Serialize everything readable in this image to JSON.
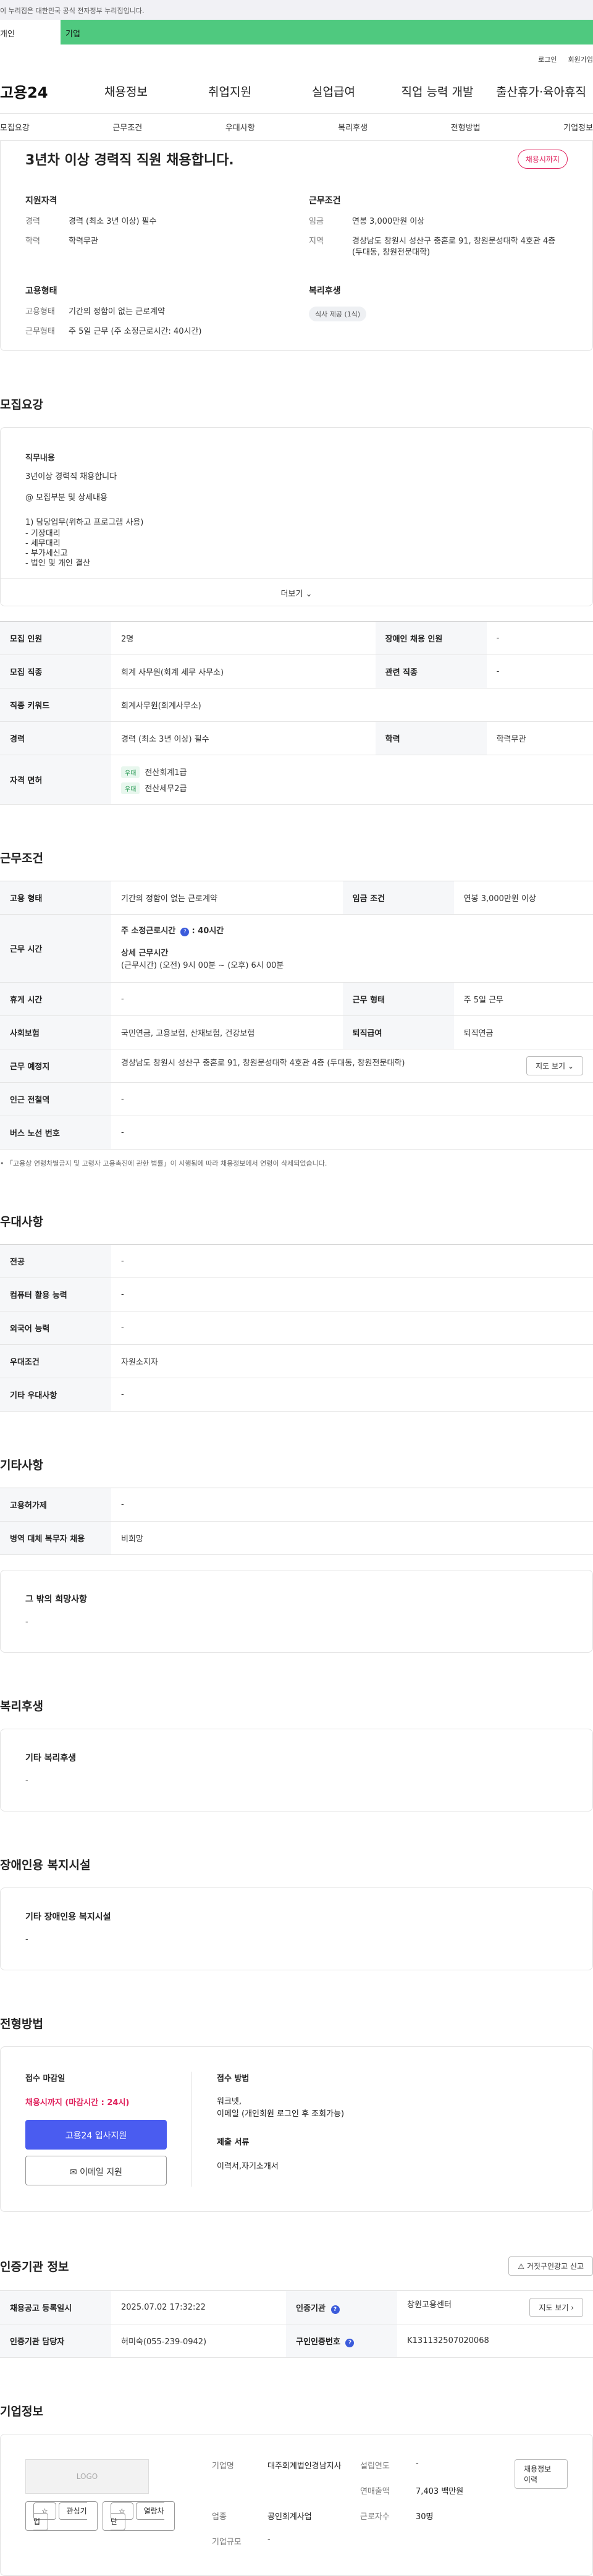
{
  "gov_banner": "이 누리집은 대한민국 공식 전자정부 누리집입니다.",
  "top_tabs": {
    "individual": "개인",
    "enterprise": "기업"
  },
  "util": {
    "login": "로그인",
    "signup": "회원가입"
  },
  "logo": "고용24",
  "gnb": [
    "채용정보",
    "취업지원",
    "실업급여",
    "직업 능력 개발",
    "출산휴가·육아휴직"
  ],
  "anchor_tabs": [
    "모집요강",
    "근무조건",
    "우대사항",
    "복리후생",
    "전형방법",
    "기업정보"
  ],
  "summary": {
    "title": "3년차 이상 경력직 직원 채용합니다.",
    "badge": "채용시까지",
    "qual_title": "지원자격",
    "qual": [
      {
        "k": "경력",
        "v": "경력 (최소 3년 이상) 필수"
      },
      {
        "k": "학력",
        "v": "학력무관"
      }
    ],
    "cond_title": "근무조건",
    "cond": [
      {
        "k": "임금",
        "v": "연봉 3,000만원 이상"
      },
      {
        "k": "지역",
        "v": "경상남도 창원시 성산구 충혼로 91, 창원문성대학 4호관 4층 (두대동, 창원전문대학)"
      }
    ],
    "emp_title": "고용형태",
    "emp": [
      {
        "k": "고용형태",
        "v": "기간의 정함이 없는 근로계약"
      },
      {
        "k": "근무형태",
        "v": "주 5일 근무 (주 소정근로시간: 40시간)"
      }
    ],
    "welfare_title": "복리후생",
    "welfare_chip": "식사 제공 (1식)"
  },
  "recruit": {
    "title": "모집요강",
    "detail_label": "직무내용",
    "detail_lines": [
      "3년이상 경력직 채용합니다",
      "@ 모집부분 및 상세내용",
      "1) 담당업무(위하고 프로그램 사용)"
    ],
    "detail_list": [
      "- 기장대리",
      "- 세무대리",
      "- 부가세신고",
      "- 법인 및 개인 결산"
    ],
    "more": "더보기",
    "rows": {
      "count_k": "모집 인원",
      "count_v": "2명",
      "disabled_k": "장애인 채용 인원",
      "disabled_v": "-",
      "job_k": "모집 직종",
      "job_v": "회계 사무원(회계 세무 사무소)",
      "related_k": "관련 직종",
      "related_v": "-",
      "keyword_k": "직종 키워드",
      "keyword_v": "회계사무원(회계사무소)",
      "career_k": "경력",
      "career_v": "경력 (최소 3년 이상) 필수",
      "edu_k": "학력",
      "edu_v": "학력무관",
      "license_k": "자격 면허",
      "license_tag": "우대",
      "license_1": "전산회계1급",
      "license_2": "전산세무2급"
    }
  },
  "work": {
    "title": "근무조건",
    "type_k": "고용 형태",
    "type_v": "기간의 정함이 없는 근로계약",
    "pay_k": "임금 조건",
    "pay_v": "연봉 3,000만원 이상",
    "hours_k": "근무 시간",
    "hours_main": "주 소정근로시간",
    "hours_val": ": 40시간",
    "hours_sub": "상세 근무시간",
    "hours_detail": "(근무시간) (오전) 9시 00분 ~ (오후) 6시 00분",
    "rest_k": "휴게 시간",
    "rest_v": "-",
    "form_k": "근무 형태",
    "form_v": "주 5일 근무",
    "ins_k": "사회보험",
    "ins_v": "국민연금, 고용보험, 산재보험, 건강보험",
    "retire_k": "퇴직급여",
    "retire_v": "퇴직연금",
    "loc_k": "근무 예정지",
    "loc_v": "경상남도 창원시 성산구 충혼로 91, 창원문성대학 4호관 4층 (두대동, 창원전문대학)",
    "map_btn": "지도 보기",
    "subway_k": "인근 전철역",
    "subway_v": "-",
    "bus_k": "버스 노선 번호",
    "bus_v": "-",
    "note": "「고용상 연령차별금지 및 고령자 고용촉진에 관한 법률」이 시행됨에 따라 채용정보에서 연령이 삭제되었습니다."
  },
  "pref": {
    "title": "우대사항",
    "rows": [
      {
        "k": "전공",
        "v": "-"
      },
      {
        "k": "컴퓨터 활용 능력",
        "v": "-"
      },
      {
        "k": "외국어 능력",
        "v": "-"
      },
      {
        "k": "우대조건",
        "v": "자원소지자"
      },
      {
        "k": "기타 우대사항",
        "v": "-"
      }
    ]
  },
  "etc": {
    "title": "기타사항",
    "rows": [
      {
        "k": "고용허가제",
        "v": "-"
      },
      {
        "k": "병역 대체 복무자 채용",
        "v": "비희망"
      }
    ],
    "box_title": "그 밖의 희망사항",
    "box_v": "-"
  },
  "welfare": {
    "title": "복리후생",
    "box_title": "기타 복리후생",
    "box_v": "-"
  },
  "facility": {
    "title": "장애인용 복지시설",
    "box_title": "기타 장애인용 복지시설",
    "box_v": "-"
  },
  "selection": {
    "title": "전형방법",
    "deadline_label": "접수 마감일",
    "deadline_v": "채용시까지 (마감시간 : 24시)",
    "apply_btn": "고용24 입사지원",
    "email_btn": "이메일 지원",
    "method_label": "접수 방법",
    "method_v1": "워크넷,",
    "method_v2": "이메일 (개인회원 로그인 후 조회가능)",
    "docs_label": "제출 서류",
    "docs_v": "이력서,자기소개서"
  },
  "agency": {
    "title": "인증기관 정보",
    "report_btn": "거짓구인광고 신고",
    "reg_k": "채용공고 등록일시",
    "reg_v": "2025.07.02 17:32:22",
    "org_k": "인증기관",
    "org_v": "창원고용센터",
    "map_btn": "지도 보기",
    "mgr_k": "인증기관 담당자",
    "mgr_v": "허미숙(055-239-0942)",
    "num_k": "구인인증번호",
    "num_v": "K131132507020068"
  },
  "company": {
    "title": "기업정보",
    "logo_text": "LOGO",
    "fav_btn": "관심기업",
    "block_btn": "열람차단",
    "jobs_btn": "채용정보 이력",
    "name_k": "기업명",
    "name_v": "대주회계법인경남지사",
    "est_k": "설립연도",
    "est_v": "-",
    "sales_k": "연매출액",
    "sales_v": "7,403 백만원",
    "ind_k": "업종",
    "ind_v": "공인회계사업",
    "emp_k": "근로자수",
    "emp_v": "30명",
    "size_k": "기업규모",
    "size_v": "-"
  }
}
